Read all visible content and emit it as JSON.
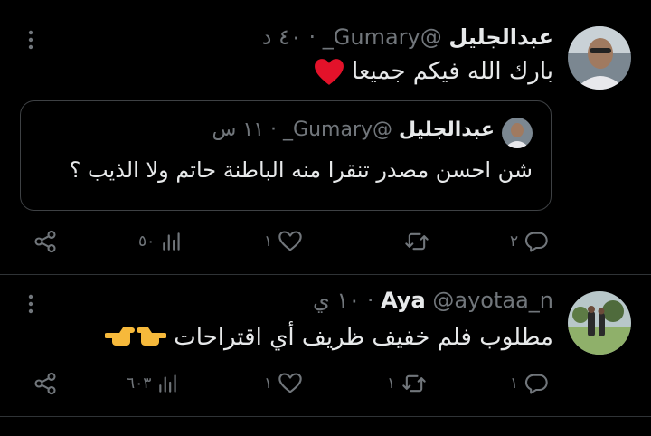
{
  "tweets": [
    {
      "name": "عبدالجليل",
      "handle": "@Gumary_",
      "separator": "·",
      "time": "٤٠ د",
      "text": "بارك الله فيكم جميعا",
      "emoji": "red-heart",
      "quote": {
        "name": "عبدالجليل",
        "handle": "@Gumary_",
        "separator": "·",
        "time": "١١ س",
        "text": "شن احسن مصدر تنقرا منه الباطنة حاتم ولا الذيب ؟"
      },
      "actions": {
        "replies": "٢",
        "retweets": "",
        "likes": "١",
        "views": "٥٠"
      }
    },
    {
      "name": "Aya",
      "handle": "@ayotaa_n",
      "separator": "·",
      "time": "١٠ ي",
      "text": "مطلوب فلم خفيف ظريف أي اقتراحات",
      "emoji": "pointing-hands",
      "actions": {
        "replies": "١",
        "retweets": "١",
        "likes": "١",
        "views": "٦٠٣"
      }
    }
  ],
  "icons": {
    "reply": "reply-icon",
    "retweet": "retweet-icon",
    "like": "heart-icon",
    "views": "views-icon",
    "share": "share-icon",
    "more": "more-vertical-icon"
  }
}
